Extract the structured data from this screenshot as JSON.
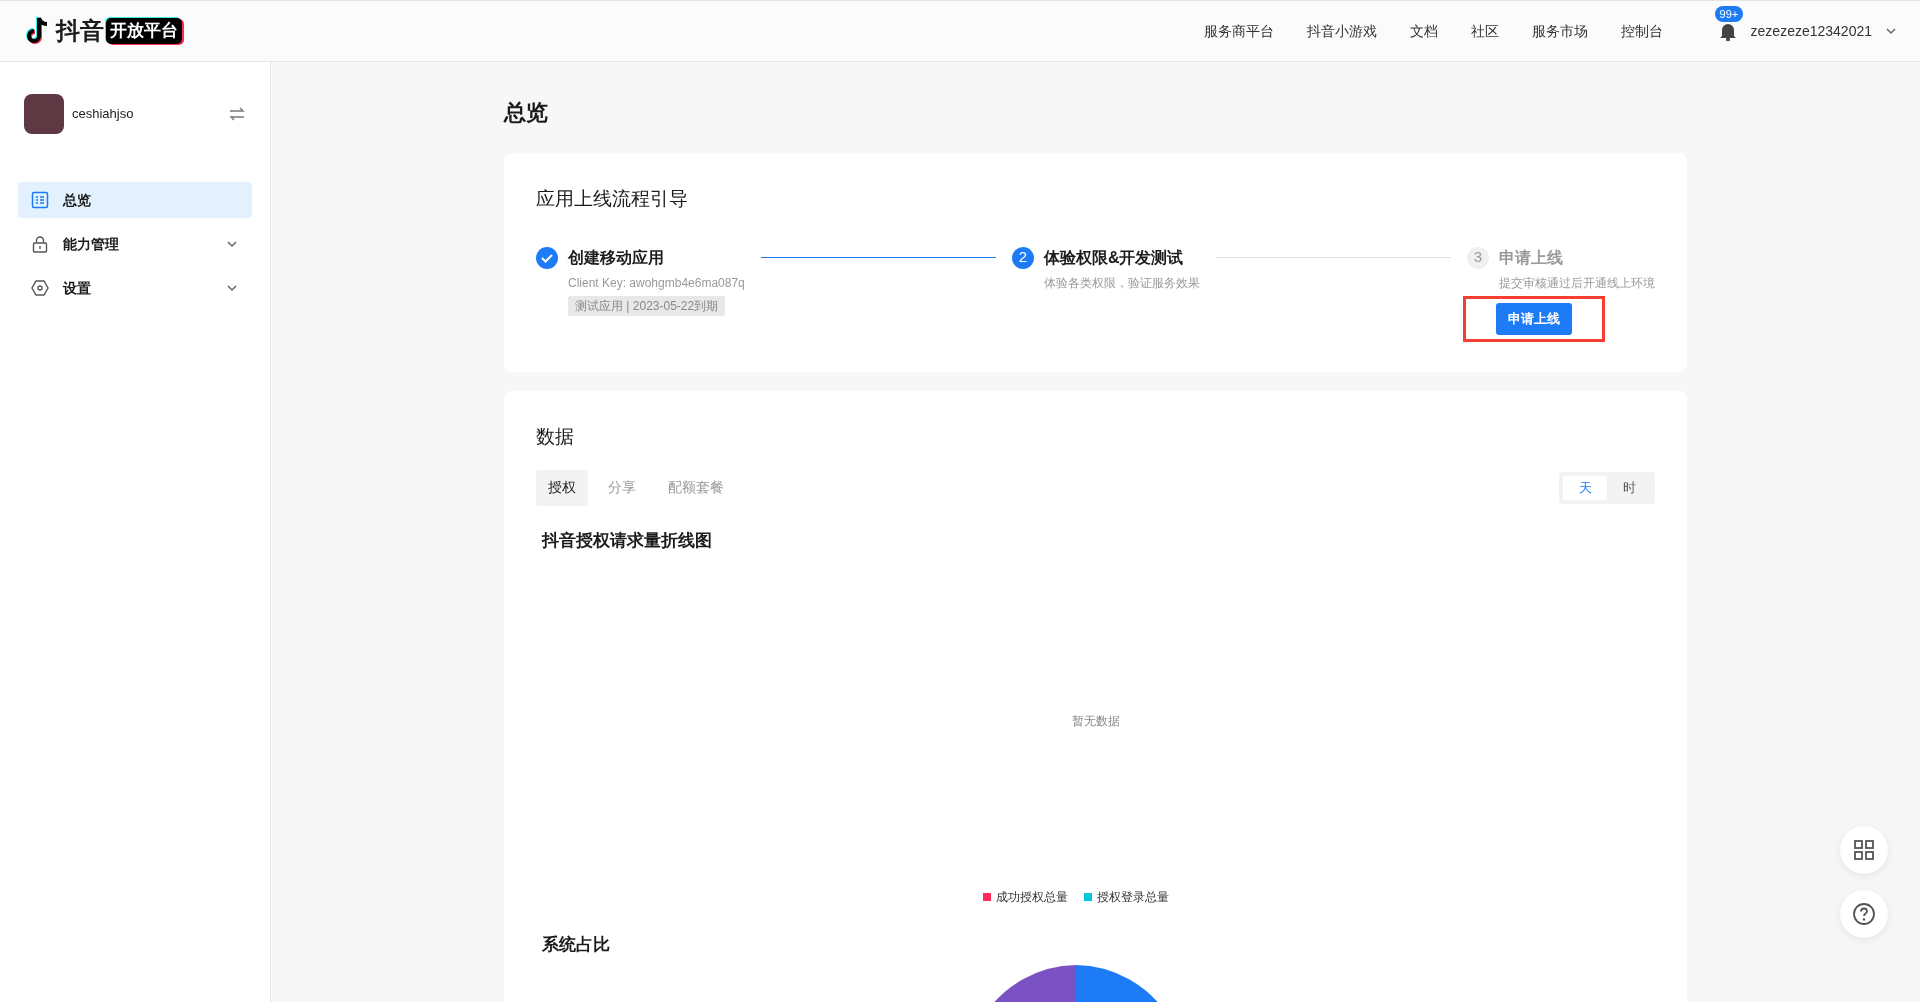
{
  "header": {
    "logo_text": "抖音",
    "logo_badge": "开放平台",
    "nav": [
      "服务商平台",
      "抖音小游戏",
      "文档",
      "社区",
      "服务市场",
      "控制台"
    ],
    "notification_badge": "99+",
    "username": "zezezeze12342021"
  },
  "sidebar": {
    "account": "ceshiahjso",
    "items": [
      {
        "label": "总览",
        "kind": "grid",
        "selected": true,
        "expandable": false
      },
      {
        "label": "能力管理",
        "kind": "lock",
        "selected": false,
        "expandable": true
      },
      {
        "label": "设置",
        "kind": "hex",
        "selected": false,
        "expandable": true
      }
    ]
  },
  "page_title": "总览",
  "guide": {
    "title": "应用上线流程引导",
    "steps": [
      {
        "kind": "done",
        "title": "创建移动应用",
        "description": "Client Key: awohgmb4e6ma087q",
        "tag": "测试应用 | 2023-05-22到期"
      },
      {
        "kind": "current",
        "number": "2",
        "title": "体验权限&开发测试",
        "description": "体验各类权限，验证服务效果"
      },
      {
        "kind": "pending",
        "number": "3",
        "title": "申请上线",
        "description": "提交审核通过后开通线上环境",
        "button": "申请上线",
        "highlighted": true
      }
    ]
  },
  "data": {
    "title": "数据",
    "tabs": [
      {
        "label": "授权",
        "selected": true
      },
      {
        "label": "分享",
        "selected": false
      },
      {
        "label": "配额套餐",
        "selected": false
      }
    ],
    "granularity": [
      {
        "label": "天",
        "selected": true
      },
      {
        "label": "时",
        "selected": false
      }
    ],
    "chart_title": "抖音授权请求量折线图",
    "empty_text": "暂无数据",
    "legend": [
      {
        "label": "成功授权总量",
        "color": "#fe2c55"
      },
      {
        "label": "授权登录总量",
        "color": "#00c8e0"
      }
    ],
    "share_title": "系统占比"
  }
}
